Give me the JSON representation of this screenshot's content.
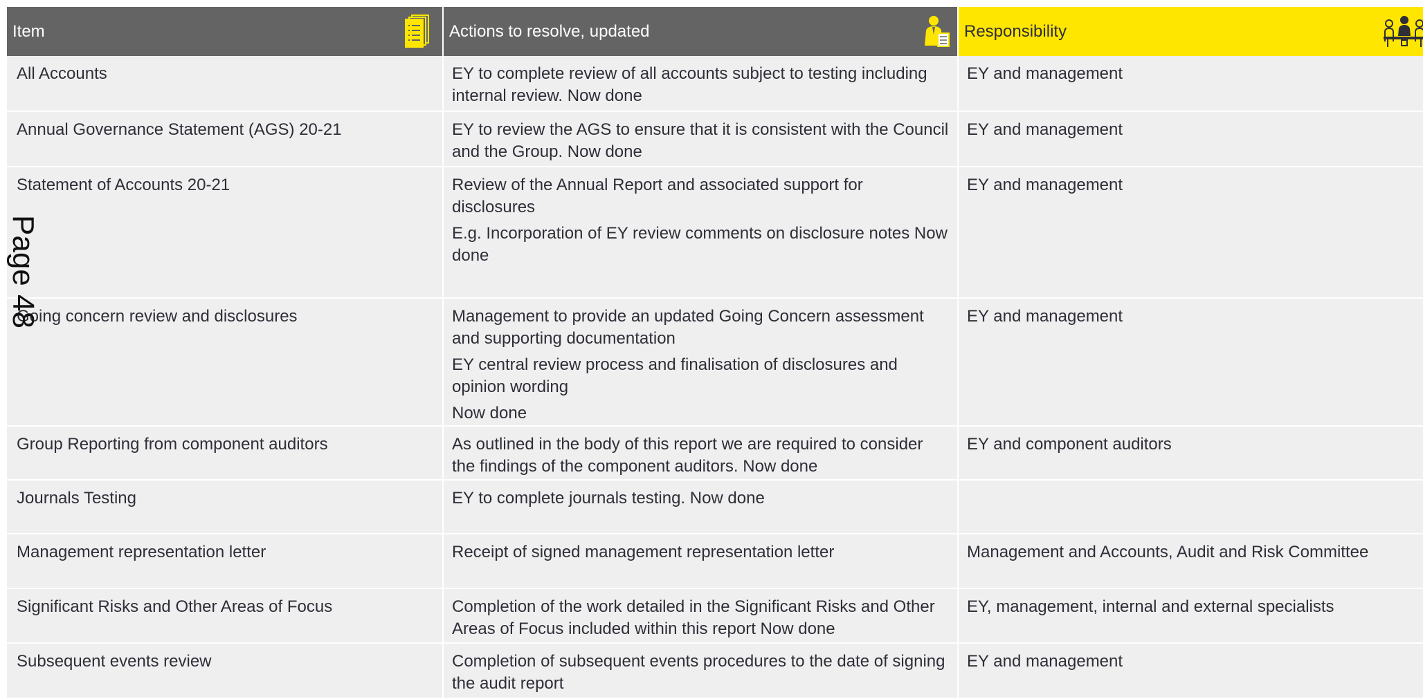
{
  "header": {
    "col1": "Item",
    "col2": "Actions to resolve, updated",
    "col3": "Responsibility",
    "icon1": "document-list-icon",
    "icon2": "person-reviewer-icon",
    "icon3": "meeting-group-icon"
  },
  "rows": [
    {
      "item": "All Accounts",
      "actions": [
        "EY to complete review of all accounts subject to testing including internal review. Now done"
      ],
      "responsibility": "EY and management"
    },
    {
      "item": "Annual Governance Statement (AGS) 20-21",
      "actions": [
        "EY to review the AGS to ensure that it is consistent with the Council and the Group. Now done"
      ],
      "responsibility": "EY and management"
    },
    {
      "item": "Statement of Accounts 20-21",
      "actions": [
        "Review of the Annual Report and associated support for disclosures",
        "E.g. Incorporation of EY review comments on disclosure notes Now done"
      ],
      "responsibility": "EY and management"
    },
    {
      "item": "Going concern review and disclosures",
      "actions": [
        "Management to provide an updated Going Concern assessment and supporting documentation",
        "EY central review process and finalisation of disclosures and opinion wording",
        "Now done"
      ],
      "responsibility": "EY and management"
    },
    {
      "item": "Group Reporting from component auditors",
      "actions": [
        "As outlined in the body of this report we are required to consider the findings of the component auditors. Now done"
      ],
      "responsibility": "EY and component auditors"
    },
    {
      "item": "Journals Testing",
      "actions": [
        "EY to complete journals testing. Now done"
      ],
      "responsibility": ""
    },
    {
      "item": "Management representation letter",
      "actions": [
        "Receipt of signed management representation letter"
      ],
      "responsibility": "Management and Accounts, Audit and Risk Committee"
    },
    {
      "item": "Significant Risks and Other Areas of Focus",
      "actions": [
        "Completion of the work detailed in the Significant Risks and Other Areas of Focus included within this report  Now done"
      ],
      "responsibility": "EY, management, internal and external specialists"
    },
    {
      "item": "Subsequent events review",
      "actions": [
        "Completion of subsequent events procedures to the date of signing the audit report"
      ],
      "responsibility": "EY and management"
    }
  ],
  "watermark": "Page 48",
  "colors": {
    "header_dark": "#646464",
    "header_yellow": "#ffe600",
    "row_bg": "#efefef",
    "text": "#2e2e38"
  }
}
